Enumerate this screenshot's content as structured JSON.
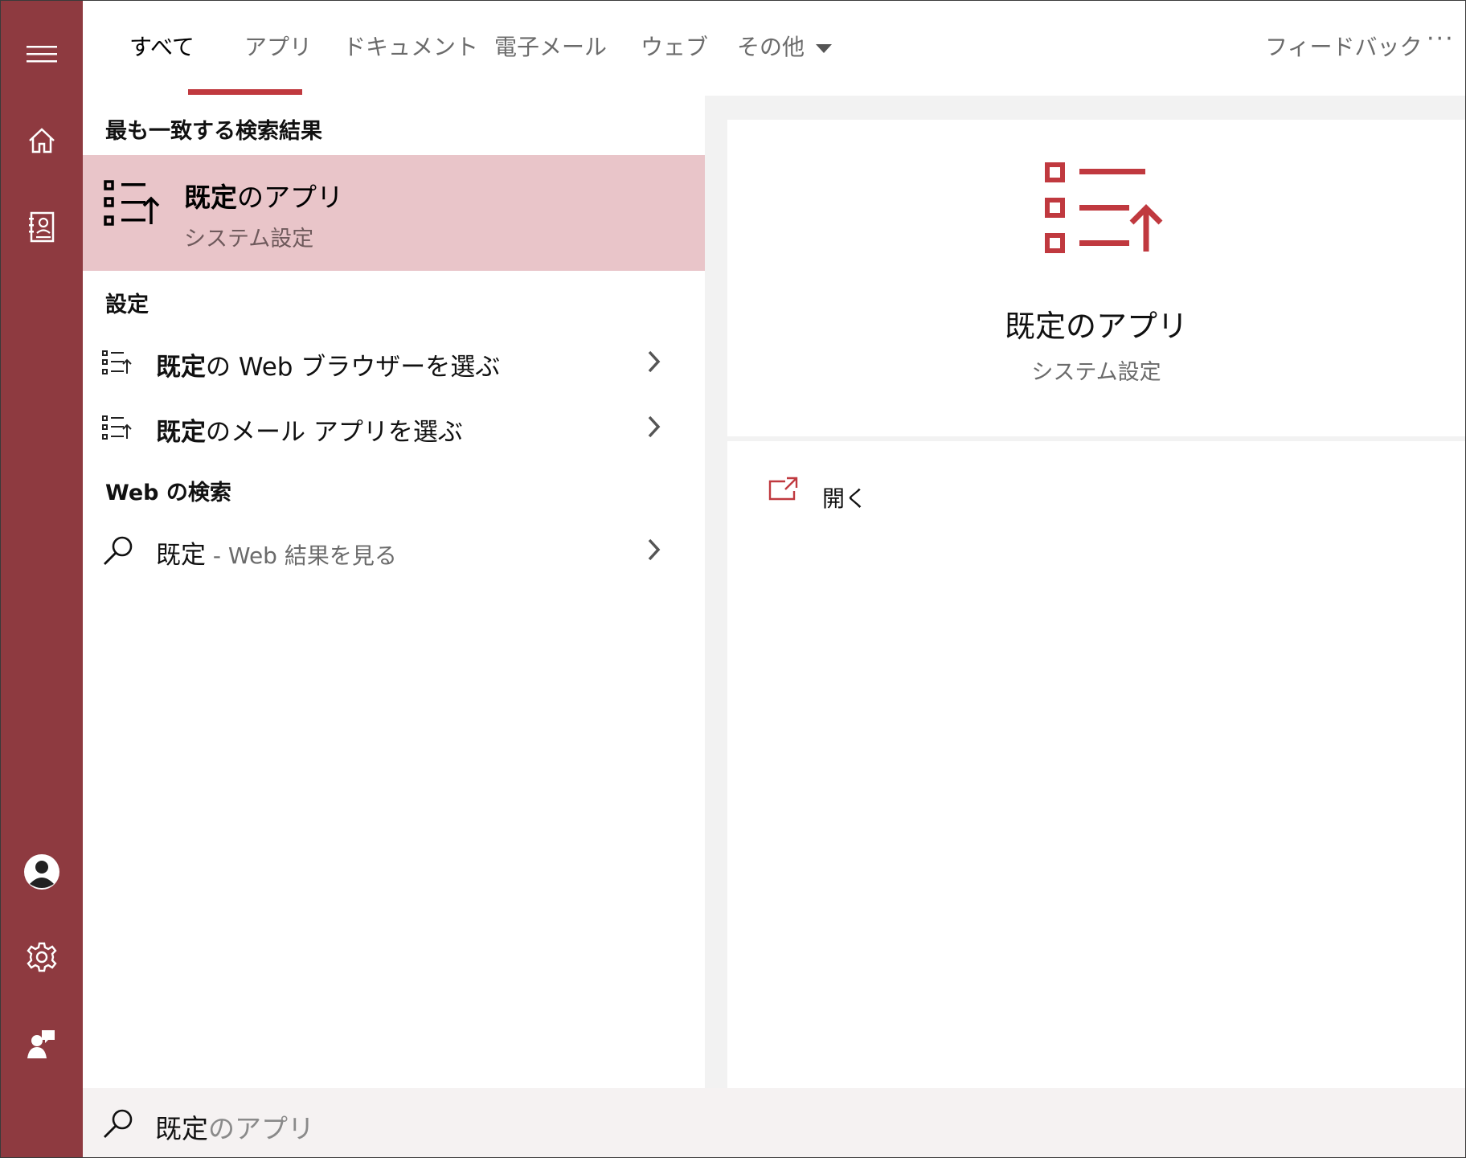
{
  "tabs": [
    {
      "label": "すべて"
    },
    {
      "label": "アプリ"
    },
    {
      "label": "ドキュメント"
    },
    {
      "label": "電子メール"
    },
    {
      "label": "ウェブ"
    },
    {
      "label": "その他"
    }
  ],
  "feedback_label": "フィードバック",
  "more_label": "···",
  "rail": {
    "icons": [
      "hamburger-icon",
      "home-icon",
      "notebook-icon",
      "account-icon",
      "settings-icon",
      "feedback-person-icon"
    ]
  },
  "best_match": {
    "section_title": "最も一致する検索結果",
    "title_bold": "既定",
    "title_rest": "のアプリ",
    "subtitle": "システム設定"
  },
  "settings": {
    "section_title": "設定",
    "items": [
      {
        "bold": "既定",
        "rest": "の Web ブラウザーを選ぶ"
      },
      {
        "bold": "既定",
        "rest": "のメール アプリを選ぶ"
      }
    ]
  },
  "web_search": {
    "section_title": "Web の検索",
    "query": "既定",
    "suffix": " - Web 結果を見る"
  },
  "preview": {
    "title": "既定のアプリ",
    "subtitle": "システム設定",
    "action_label": "開く"
  },
  "search": {
    "typed": "既定",
    "suggestion": "のアプリ"
  },
  "colors": {
    "accent": "#c0393f",
    "rail": "#8e3a40",
    "selected_bg": "#e9c5c9"
  }
}
